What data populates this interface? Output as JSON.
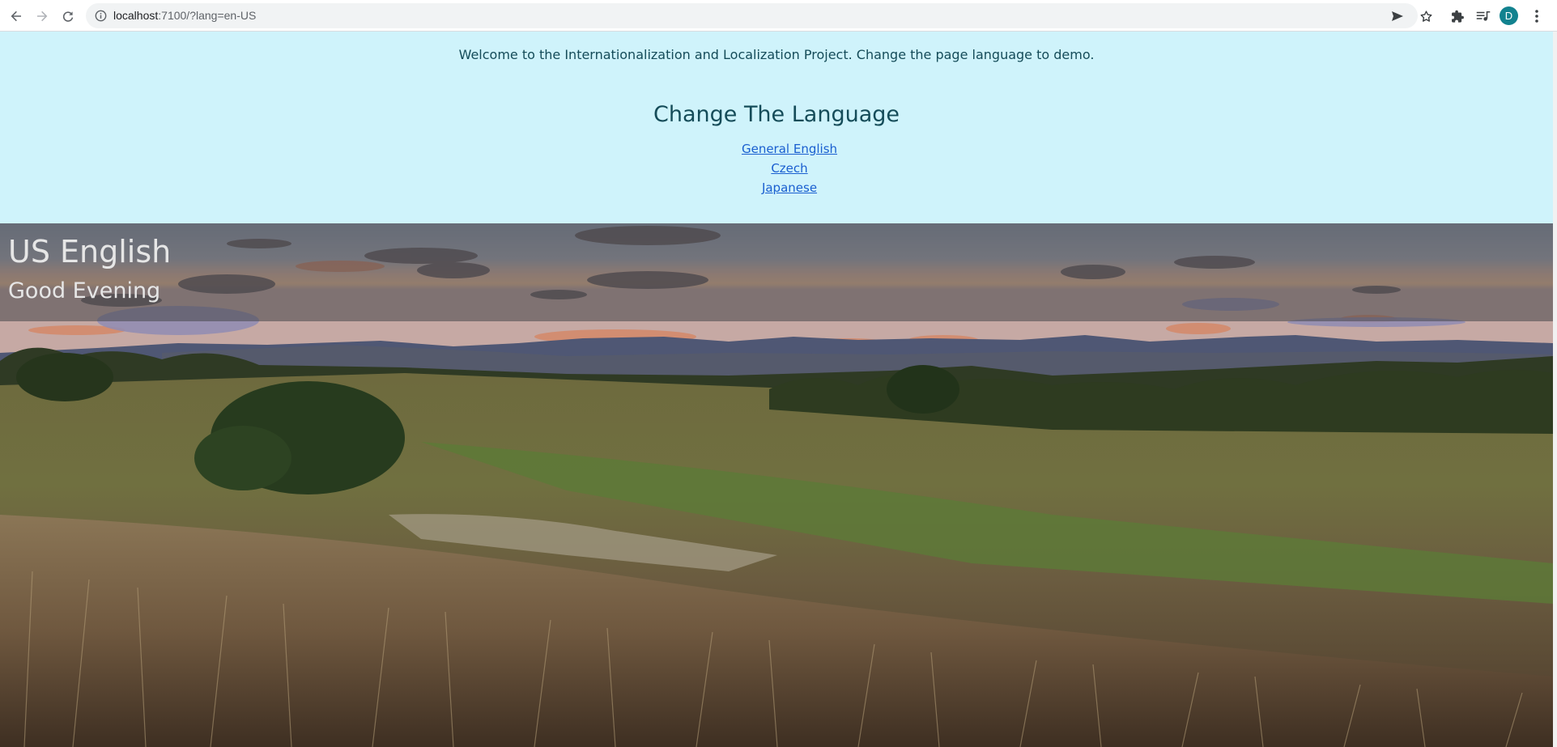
{
  "browser": {
    "url_host": "localhost",
    "url_rest": ":7100/?lang=en-US",
    "profile_initial": "D",
    "icons": {
      "back": "arrow-left-icon",
      "forward": "arrow-right-icon",
      "reload": "reload-icon",
      "site_info": "info-icon",
      "send": "send-icon",
      "bookmark": "star-icon",
      "extensions": "puzzle-icon",
      "media": "media-queue-icon",
      "menu": "kebab-menu-icon"
    }
  },
  "intro": {
    "welcome": "Welcome to the Internationalization and Localization Project. Change the page language to demo.",
    "heading": "Change The Language",
    "links": [
      {
        "label": "General English"
      },
      {
        "label": "Czech"
      },
      {
        "label": "Japanese"
      }
    ]
  },
  "banner": {
    "locale_name": "US English",
    "greeting": "Good Evening"
  },
  "colors": {
    "intro_bg": "#cff3fb",
    "intro_text": "#154c59",
    "link": "#1a5fd0",
    "banner_overlay": "#464648",
    "banner_text": "#e6e6e6",
    "avatar": "#12828f"
  }
}
